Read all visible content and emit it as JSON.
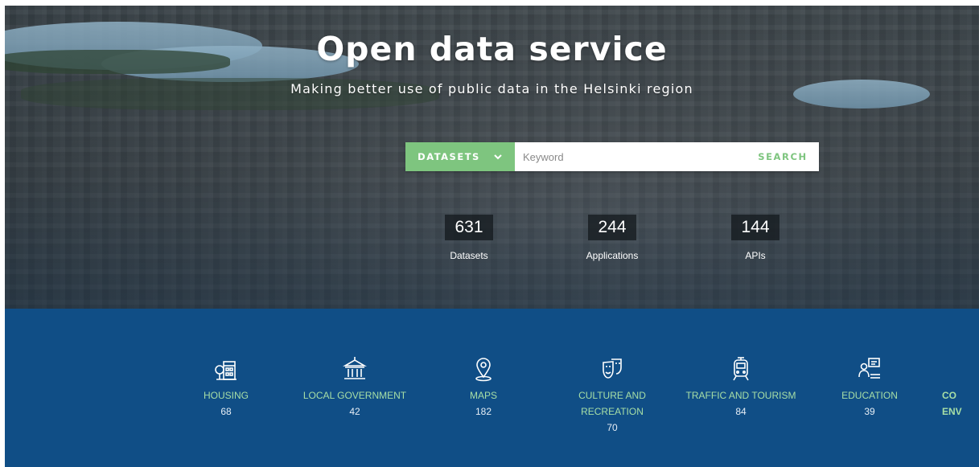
{
  "hero": {
    "title": "Open data service",
    "subtitle": "Making better use of public data in the Helsinki region"
  },
  "search": {
    "dropdown_label": "DATASETS",
    "placeholder": "Keyword",
    "button_label": "SEARCH"
  },
  "stats": [
    {
      "value": "631",
      "label": "Datasets"
    },
    {
      "value": "244",
      "label": "Applications"
    },
    {
      "value": "144",
      "label": "APIs"
    }
  ],
  "categories": [
    {
      "name": "HOUSING",
      "count": "68",
      "icon": "housing-icon"
    },
    {
      "name": "LOCAL GOVERNMENT",
      "count": "42",
      "icon": "government-building-icon"
    },
    {
      "name": "MAPS",
      "count": "182",
      "icon": "map-pin-icon"
    },
    {
      "name": "CULTURE AND RECREATION",
      "count": "70",
      "icon": "theatre-masks-icon"
    },
    {
      "name": "TRAFFIC AND TOURISM",
      "count": "84",
      "icon": "tram-icon"
    },
    {
      "name": "EDUCATION",
      "count": "39",
      "icon": "teacher-board-icon"
    },
    {
      "name": "CO\nENV",
      "count": "",
      "icon": ""
    }
  ],
  "colors": {
    "accent_green": "#7ec57f",
    "category_blue": "#104e86",
    "category_label": "#a7dfa6"
  }
}
